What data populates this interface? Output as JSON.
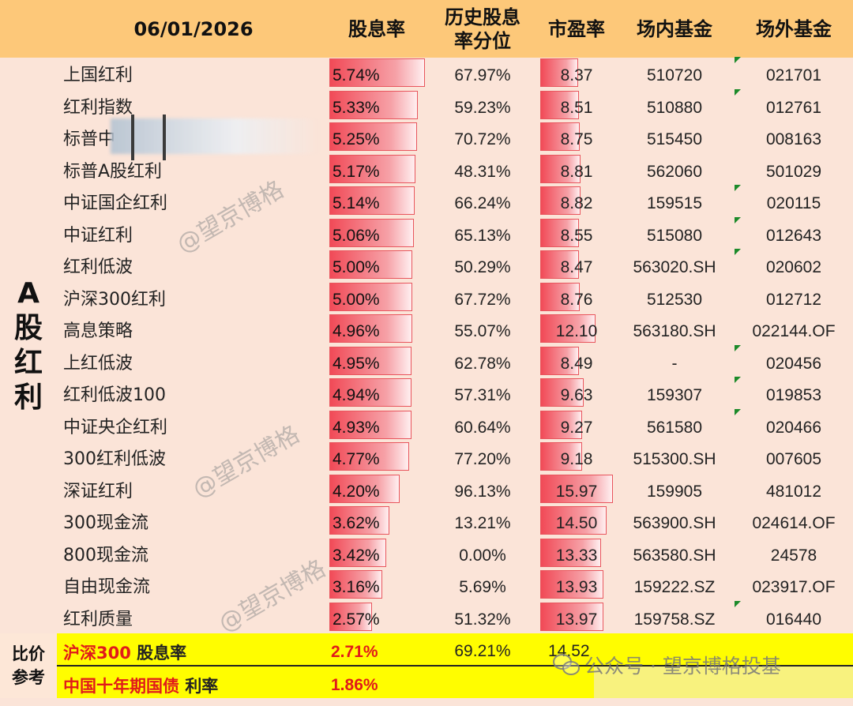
{
  "header": {
    "date": "06/01/2026",
    "col_yield": "股息率",
    "col_percentile": "历史股息率分位",
    "col_pe": "市盈率",
    "col_onexchange": "场内基金",
    "col_offexchange": "场外基金"
  },
  "section_label": "A股红利",
  "rows": [
    {
      "name": "上国红利",
      "yield": "5.74%",
      "yield_value": 5.74,
      "percentile": "67.97%",
      "pe": "8.37",
      "pe_value": 8.37,
      "on_exchange": "510720",
      "off_exchange": "021701",
      "flag": true
    },
    {
      "name": "红利指数",
      "yield": "5.33%",
      "yield_value": 5.33,
      "percentile": "59.23%",
      "pe": "8.51",
      "pe_value": 8.51,
      "on_exchange": "510880",
      "off_exchange": "012761",
      "flag": true
    },
    {
      "name": "标普中",
      "yield": "5.25%",
      "yield_value": 5.25,
      "percentile": "70.72%",
      "pe": "8.75",
      "pe_value": 8.75,
      "on_exchange": "515450",
      "off_exchange": "008163",
      "flag": false
    },
    {
      "name": "标普A股红利",
      "yield": "5.17%",
      "yield_value": 5.17,
      "percentile": "48.31%",
      "pe": "8.81",
      "pe_value": 8.81,
      "on_exchange": "562060",
      "off_exchange": "501029",
      "flag": false
    },
    {
      "name": "中证国企红利",
      "yield": "5.14%",
      "yield_value": 5.14,
      "percentile": "66.24%",
      "pe": "8.82",
      "pe_value": 8.82,
      "on_exchange": "159515",
      "off_exchange": "020115",
      "flag": true
    },
    {
      "name": "中证红利",
      "yield": "5.06%",
      "yield_value": 5.06,
      "percentile": "65.13%",
      "pe": "8.55",
      "pe_value": 8.55,
      "on_exchange": "515080",
      "off_exchange": "012643",
      "flag": true
    },
    {
      "name": "红利低波",
      "yield": "5.00%",
      "yield_value": 5.0,
      "percentile": "50.29%",
      "pe": "8.47",
      "pe_value": 8.47,
      "on_exchange": "563020.SH",
      "off_exchange": "020602",
      "flag": true
    },
    {
      "name": "沪深300红利",
      "yield": "5.00%",
      "yield_value": 5.0,
      "percentile": "67.72%",
      "pe": "8.76",
      "pe_value": 8.76,
      "on_exchange": "512530",
      "off_exchange": "012712",
      "flag": false
    },
    {
      "name": "高息策略",
      "yield": "4.96%",
      "yield_value": 4.96,
      "percentile": "55.07%",
      "pe": "12.10",
      "pe_value": 12.1,
      "on_exchange": "563180.SH",
      "off_exchange": "022144.OF",
      "flag": false
    },
    {
      "name": "上红低波",
      "yield": "4.95%",
      "yield_value": 4.95,
      "percentile": "62.78%",
      "pe": "8.49",
      "pe_value": 8.49,
      "on_exchange": "-",
      "off_exchange": "020456",
      "flag": true
    },
    {
      "name": "红利低波100",
      "yield": "4.94%",
      "yield_value": 4.94,
      "percentile": "57.31%",
      "pe": "9.63",
      "pe_value": 9.63,
      "on_exchange": "159307",
      "off_exchange": "019853",
      "flag": true
    },
    {
      "name": "中证央企红利",
      "yield": "4.93%",
      "yield_value": 4.93,
      "percentile": "60.64%",
      "pe": "9.27",
      "pe_value": 9.27,
      "on_exchange": "561580",
      "off_exchange": "020466",
      "flag": true
    },
    {
      "name": "300红利低波",
      "yield": "4.77%",
      "yield_value": 4.77,
      "percentile": "77.20%",
      "pe": "9.18",
      "pe_value": 9.18,
      "on_exchange": "515300.SH",
      "off_exchange": "007605",
      "flag": false
    },
    {
      "name": "深证红利",
      "yield": "4.20%",
      "yield_value": 4.2,
      "percentile": "96.13%",
      "pe": "15.97",
      "pe_value": 15.97,
      "on_exchange": "159905",
      "off_exchange": "481012",
      "flag": false
    },
    {
      "name": "300现金流",
      "yield": "3.62%",
      "yield_value": 3.62,
      "percentile": "13.21%",
      "pe": "14.50",
      "pe_value": 14.5,
      "on_exchange": "563900.SH",
      "off_exchange": "024614.OF",
      "flag": false
    },
    {
      "name": "800现金流",
      "yield": "3.42%",
      "yield_value": 3.42,
      "percentile": "0.00%",
      "pe": "13.33",
      "pe_value": 13.33,
      "on_exchange": "563580.SH",
      "off_exchange": "24578",
      "flag": false
    },
    {
      "name": "自由现金流",
      "yield": "3.16%",
      "yield_value": 3.16,
      "percentile": "5.69%",
      "pe": "13.93",
      "pe_value": 13.93,
      "on_exchange": "159222.SZ",
      "off_exchange": "023917.OF",
      "flag": false
    },
    {
      "name": "红利质量",
      "yield": "2.57%",
      "yield_value": 2.57,
      "percentile": "51.32%",
      "pe": "13.97",
      "pe_value": 13.97,
      "on_exchange": "159758.SZ",
      "off_exchange": "016440",
      "flag": true
    }
  ],
  "footer": {
    "label": "比价参考",
    "row1_label_red": "沪深300",
    "row1_label_black": "股息率",
    "row1_yield": "2.71%",
    "row1_percentile": "69.21%",
    "row1_pe": "14.52",
    "row2_label_red": "中国十年期国债",
    "row2_label_black": "利率",
    "row2_yield": "1.86%"
  },
  "watermarks": {
    "handle": "@望京博格",
    "wechat": "公众号 · 望京博格投基"
  },
  "colors": {
    "header_bg": "#fdc879",
    "body_bg": "#fbe4d8",
    "bar_red": "#f14a57",
    "highlight_yellow": "#fffd00",
    "accent_red": "#e11a1a",
    "flag_green": "#1c8a2a"
  }
}
